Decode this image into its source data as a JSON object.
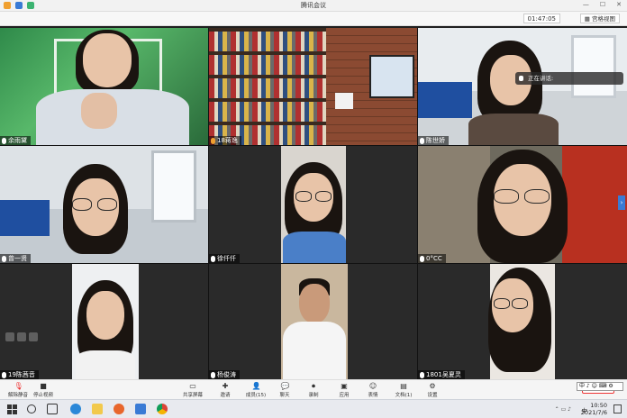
{
  "window": {
    "title": "腾讯会议"
  },
  "header": {
    "timer": "01:47:05",
    "view_label": "宫格视图"
  },
  "speaking": {
    "label": "正在讲话:"
  },
  "tiles": [
    {
      "name": "余雨黛"
    },
    {
      "name": "18蒋逸"
    },
    {
      "name": "陈世娇"
    },
    {
      "name": "曾一贤"
    },
    {
      "name": "徐仟仟"
    },
    {
      "name": "0°CC"
    },
    {
      "name": "19陈茜音"
    },
    {
      "name": "杨俊涛"
    },
    {
      "name": "1801吴夏灵"
    }
  ],
  "toolbar": {
    "mute": "解除静音",
    "video": "停止视频",
    "share": "共享屏幕",
    "invite": "邀请",
    "members": "成员(15)",
    "chat": "聊天",
    "record": "录制",
    "apps": "应用",
    "reactions": "表情",
    "docs": "文档(1)",
    "settings": "设置",
    "end": "离开会议"
  },
  "taskbar": {
    "time": "10:50",
    "date": "2021/7/6",
    "lang": "中",
    "ime": "CH",
    "ime_bar": "中 ♪ ☺ ⌨ ⚙"
  }
}
